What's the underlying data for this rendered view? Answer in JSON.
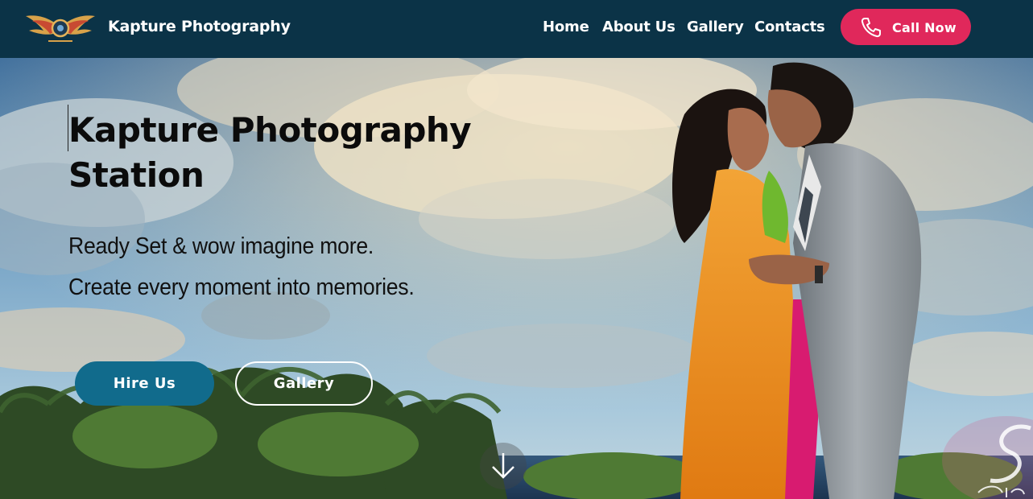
{
  "navbar": {
    "logo_icon": "winged-camera-logo",
    "brand": "Kapture Photography",
    "links": [
      "Home",
      "About Us",
      "Gallery",
      "Contacts"
    ],
    "call_button": {
      "label": "Call Now",
      "icon": "phone-icon"
    }
  },
  "hero": {
    "title": "Kapture Photography Station",
    "tagline_1": "Ready Set & wow imagine more.",
    "tagline_2": "Create every moment into memories.",
    "primary_button": "Hire Us",
    "secondary_button": "Gallery",
    "scroll_icon": "arrow-down-icon"
  },
  "colors": {
    "navbar_bg": "#0b3347",
    "call_button_bg": "#e0285b",
    "hire_button_bg": "#116b8c"
  }
}
